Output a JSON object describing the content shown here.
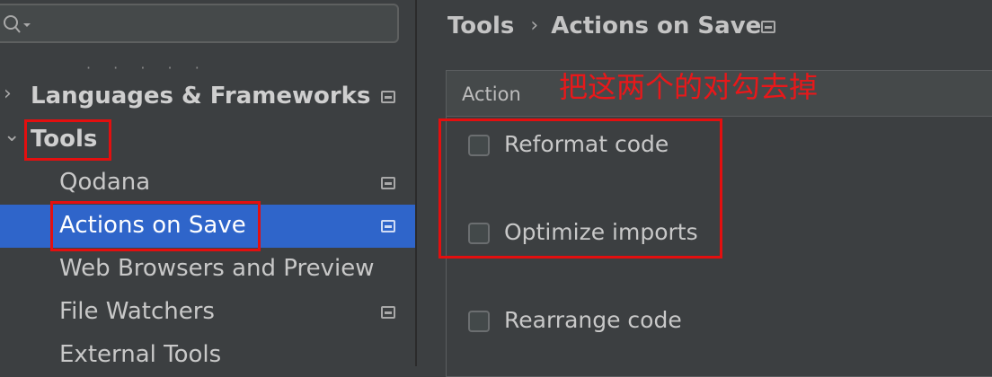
{
  "sidebar": {
    "search": {
      "value": ""
    },
    "clipped_text": "· · · · ·",
    "items": [
      {
        "label": "Languages & Frameworks",
        "expanded": false,
        "icon": "chevron-right-icon"
      },
      {
        "label": "Tools",
        "expanded": true,
        "icon": "chevron-down-icon"
      },
      {
        "label": "Qodana"
      },
      {
        "label": "Actions on Save",
        "selected": true
      },
      {
        "label": "Web Browsers and Preview"
      },
      {
        "label": "File Watchers"
      },
      {
        "label": "External Tools"
      }
    ]
  },
  "breadcrumb": {
    "parent": "Tools",
    "separator": "›",
    "current": "Actions on Save"
  },
  "actions_panel": {
    "header": "Action",
    "actions": [
      {
        "label": "Reformat code",
        "checked": false
      },
      {
        "label": "Optimize imports",
        "checked": false
      },
      {
        "label": "Rearrange code",
        "checked": false
      }
    ]
  },
  "annotation": {
    "text": "把这两个的对勾去掉",
    "color": "#e8181a"
  },
  "colors": {
    "background": "#3c3f41",
    "selection": "#2f65ca",
    "highlight_box": "#e30f0f"
  }
}
